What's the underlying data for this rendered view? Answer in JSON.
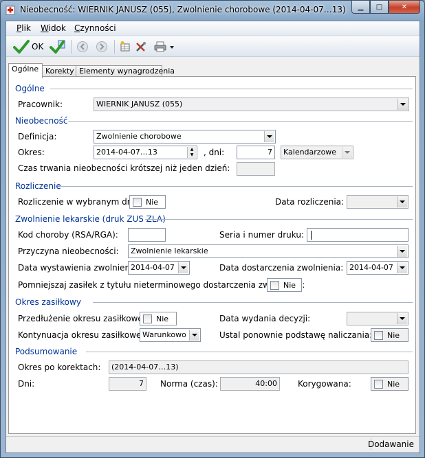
{
  "window": {
    "title": "Nieobecność: WIERNIK JANUSZ (055), Zwolnienie chorobowe (2014-04-07…13)",
    "buttons": {
      "minimize": "▁",
      "maximize": "□",
      "close": "✕"
    }
  },
  "menu": {
    "items": [
      "Plik",
      "Widok",
      "Czynności"
    ],
    "underline": [
      "P",
      "W",
      "C"
    ]
  },
  "toolbar": {
    "ok_label": "OK"
  },
  "tabs": [
    "Ogólne",
    "Korekty",
    "Elementy wynagrodzenia"
  ],
  "sections": {
    "ogolne": {
      "title": "Ogólne",
      "pracownik_label": "Pracownik:",
      "pracownik_value": "WIERNIK JANUSZ (055)"
    },
    "nieobecnosc": {
      "title": "Nieobecność",
      "definicja_label": "Definicja:",
      "definicja_value": "Zwolnienie chorobowe",
      "okres_label": "Okres:",
      "okres_value": "2014-04-07…13",
      "dni_label": ", dni:",
      "dni_value": "7",
      "kalendarz_value": "Kalendarzowe",
      "czas_label": "Czas trwania nieobecności krótszej niż jeden dzień:",
      "czas_value": ""
    },
    "rozliczenie": {
      "title": "Rozliczenie",
      "w_dniu_label": "Rozliczenie w wybranym dniu:",
      "w_dniu_value": "Nie",
      "data_label": "Data rozliczenia:",
      "data_value": ""
    },
    "zwolnienie": {
      "title": "Zwolnienie lekarskie (druk ZUS ZLA)",
      "kod_label": "Kod choroby (RSA/RGA):",
      "kod_value": "",
      "seria_label": "Seria i numer druku:",
      "seria_value": "",
      "przyczyna_label": "Przyczyna nieobecności:",
      "przyczyna_value": "Zwolnienie lekarskie",
      "data_wyst_label": "Data wystawienia zwolnienia:",
      "data_wyst_value": "2014-04-07",
      "data_dost_label": "Data dostarczenia zwolnienia:",
      "data_dost_value": "2014-04-07",
      "pomniejszaj_label": "Pomniejszaj zasiłek z tytułu nieterminowego dostarczenia zwolnienia:",
      "pomniejszaj_value": "Nie"
    },
    "okres_zasilkowy": {
      "title": "Okres zasiłkowy",
      "przedluzenie_label": "Przedłużenie okresu zasiłkowego:",
      "przedluzenie_value": "Nie",
      "data_decyzji_label": "Data wydania decyzji:",
      "data_decyzji_value": "",
      "kontynuacja_label": "Kontynuacja okresu zasiłkowego:",
      "kontynuacja_value": "Warunkowo",
      "ustal_label": "Ustal ponownie podstawę naliczania:",
      "ustal_value": "Nie"
    },
    "podsumowanie": {
      "title": "Podsumowanie",
      "okres_label": "Okres po korektach:",
      "okres_value": "(2014-04-07…13)",
      "dni_label": "Dni:",
      "dni_value": "7",
      "norma_label": "Norma (czas):",
      "norma_value": "40:00",
      "korygowana_label": "Korygowana:",
      "korygowana_value": "Nie"
    }
  },
  "status": {
    "mode": "Dodawanie"
  }
}
